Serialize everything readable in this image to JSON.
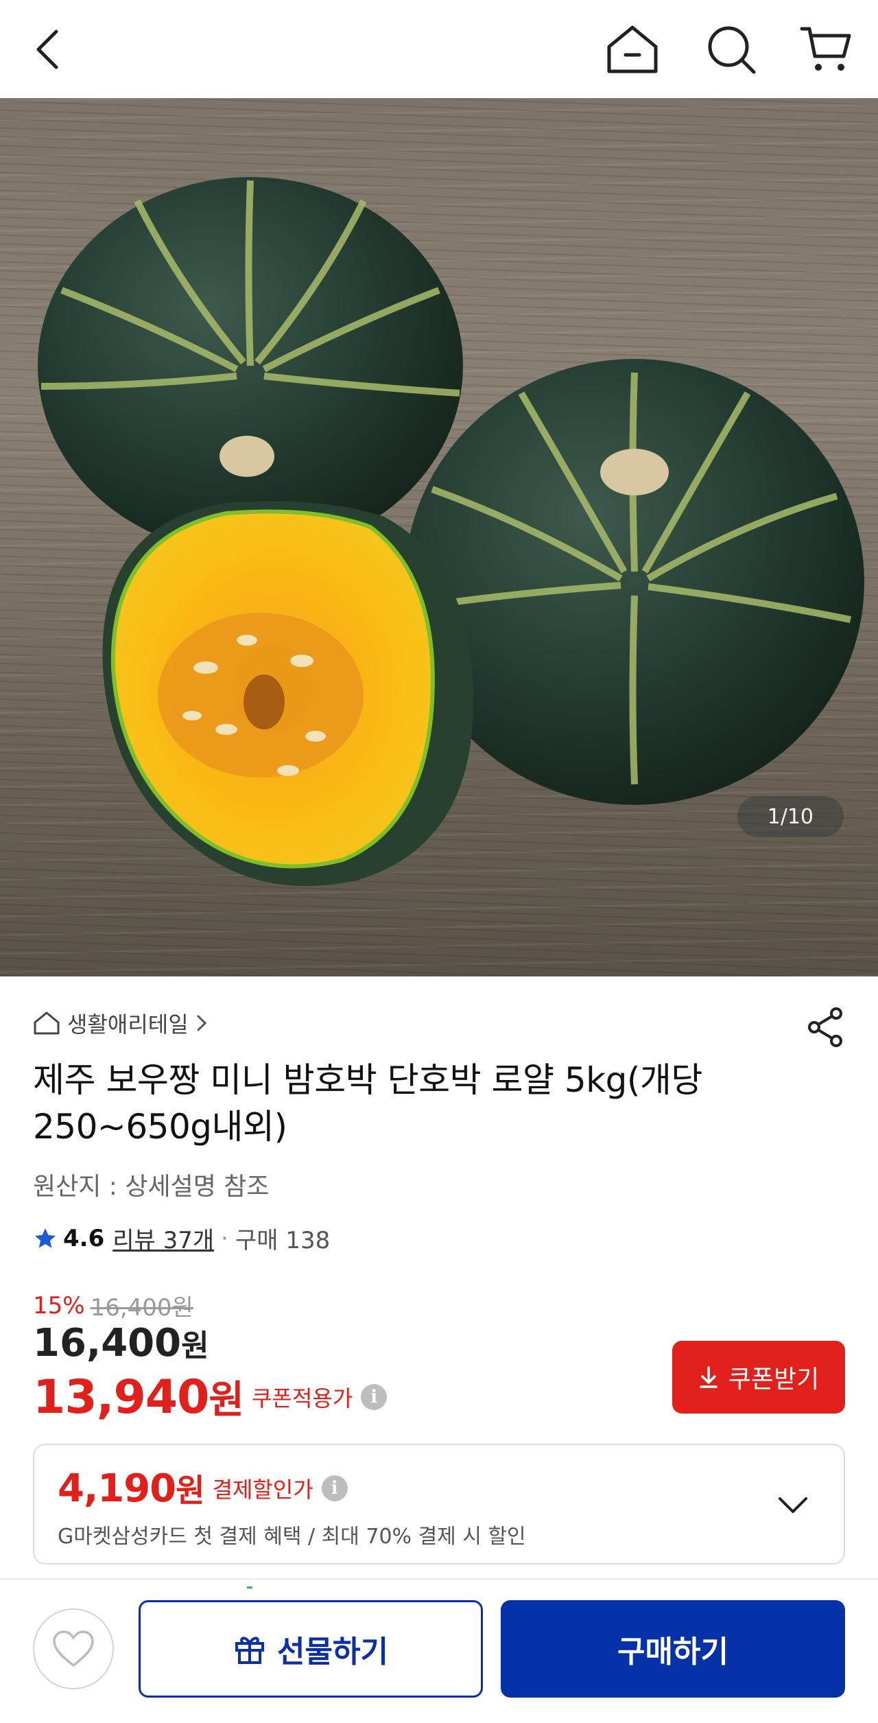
{
  "header": {
    "icons": [
      "back-icon",
      "home-icon",
      "search-icon",
      "cart-icon"
    ]
  },
  "gallery": {
    "counter": "1/10"
  },
  "product": {
    "breadcrumb": "생활애리테일",
    "title": "제주 보우짱 미니 밤호박 단호박 로얄 5kg(개당 250~650g내외)",
    "origin": "원산지 : 상세설명 참조",
    "rating": "4.6",
    "reviews": "리뷰 37개",
    "separator": "·",
    "purchases": "구매 138"
  },
  "pricing": {
    "discount_pct": "15%",
    "original_price": "16,400원",
    "price_number": "16,400",
    "price_unit": "원",
    "coupon_price_number": "13,940",
    "coupon_price_unit": "원",
    "coupon_label": "쿠폰적용가",
    "coupon_button": "쿠폰받기",
    "accent_color": "#e1201b"
  },
  "payment_benefit": {
    "amount_number": "4,190",
    "amount_unit": "원",
    "label": "결제할인가",
    "description": "G마켓삼성카드 첫 결제 혜택 / 최대 70% 결제 시 할인"
  },
  "bottom_bar": {
    "gift_label": "선물하기",
    "buy_label": "구매하기",
    "brand_color": "#0532a8"
  }
}
